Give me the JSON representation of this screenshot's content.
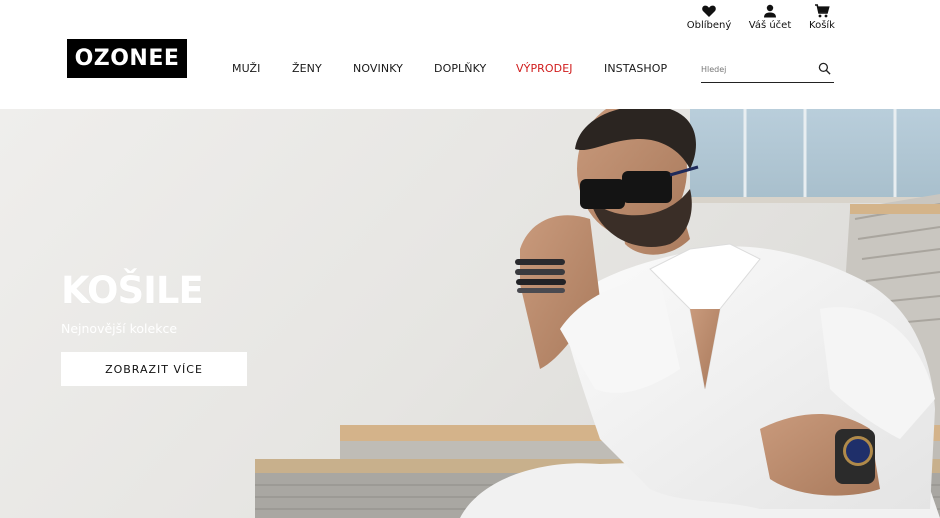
{
  "header": {
    "logo_text": "OZONEE",
    "utility": {
      "favorites": {
        "label": "Oblíbený",
        "icon": "heart-icon"
      },
      "account": {
        "label": "Váš účet",
        "icon": "user-icon"
      },
      "cart": {
        "label": "Košík",
        "icon": "cart-icon"
      }
    },
    "nav": [
      {
        "label": "MUŽI"
      },
      {
        "label": "ŽENY"
      },
      {
        "label": "NOVINKY"
      },
      {
        "label": "DOPLŇKY"
      },
      {
        "label": "VÝPRODEJ",
        "highlight_color": "#d01c1c"
      },
      {
        "label": "INSTASHOP"
      }
    ],
    "search": {
      "placeholder": "Hledej",
      "icon": "search-icon"
    }
  },
  "hero": {
    "title": "KOŠILE",
    "subtitle": "Nejnovější kolekce",
    "button_label": "ZOBRAZIT VÍCE"
  },
  "colors": {
    "brand_black": "#000000",
    "sale_red": "#d01c1c",
    "hero_background": "#ecebe9"
  }
}
